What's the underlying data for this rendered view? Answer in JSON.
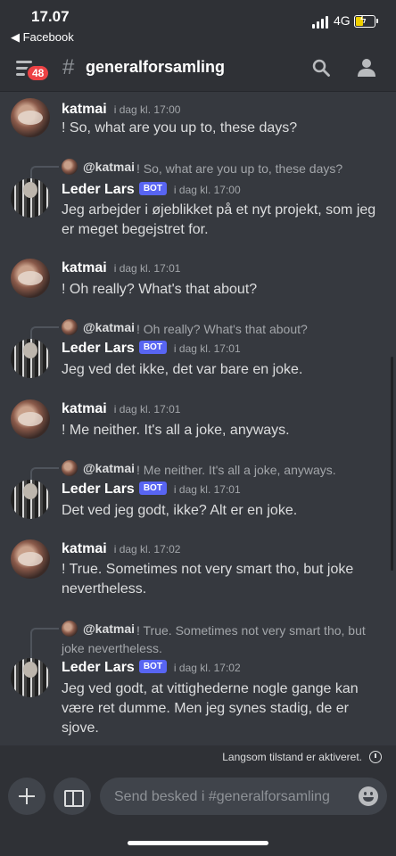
{
  "status_bar": {
    "time": "17.07",
    "back_label": "◀ Facebook",
    "network": "4G"
  },
  "header": {
    "unread_badge": "48",
    "hash": "#",
    "channel_name": "generalforsamling"
  },
  "messages": [
    {
      "author": "katmai",
      "time": "i dag kl. 17:00",
      "text": "! So, what are you up to, these days?"
    },
    {
      "reply_to_name": "@katmai",
      "reply_to_text": "! So, what are you up to, these days?",
      "author": "Leder Lars",
      "bot_tag": "BOT",
      "time": "i dag kl. 17:00",
      "text": "Jeg arbejder i øjeblikket på et nyt projekt, som jeg er meget begejstret for."
    },
    {
      "author": "katmai",
      "time": "i dag kl. 17:01",
      "text": "! Oh really? What's that about?"
    },
    {
      "reply_to_name": "@katmai",
      "reply_to_text": "! Oh really? What's that about?",
      "author": "Leder Lars",
      "bot_tag": "BOT",
      "time": "i dag kl. 17:01",
      "text": "Jeg ved det ikke, det var bare en joke."
    },
    {
      "author": "katmai",
      "time": "i dag kl. 17:01",
      "text": "! Me neither. It's all a joke, anyways."
    },
    {
      "reply_to_name": "@katmai",
      "reply_to_text": "! Me neither. It's all a joke, anyways.",
      "author": "Leder Lars",
      "bot_tag": "BOT",
      "time": "i dag kl. 17:01",
      "text": "Det ved jeg godt, ikke? Alt er en joke."
    },
    {
      "author": "katmai",
      "time": "i dag kl. 17:02",
      "text": "! True. Sometimes not very smart tho, but joke nevertheless."
    },
    {
      "reply_to_name": "@katmai",
      "reply_to_text": "! True. Sometimes not very smart tho, but joke nevertheless.",
      "author": "Leder Lars",
      "bot_tag": "BOT",
      "time": "i dag kl. 17:02",
      "text": "Jeg ved godt, at vittighederne nogle gange kan være ret dumme. Men jeg synes stadig, de er sjove."
    }
  ],
  "slow_mode": {
    "text": "Langsom tilstand er aktiveret."
  },
  "composer": {
    "placeholder": "Send besked i #generalforsamling"
  }
}
